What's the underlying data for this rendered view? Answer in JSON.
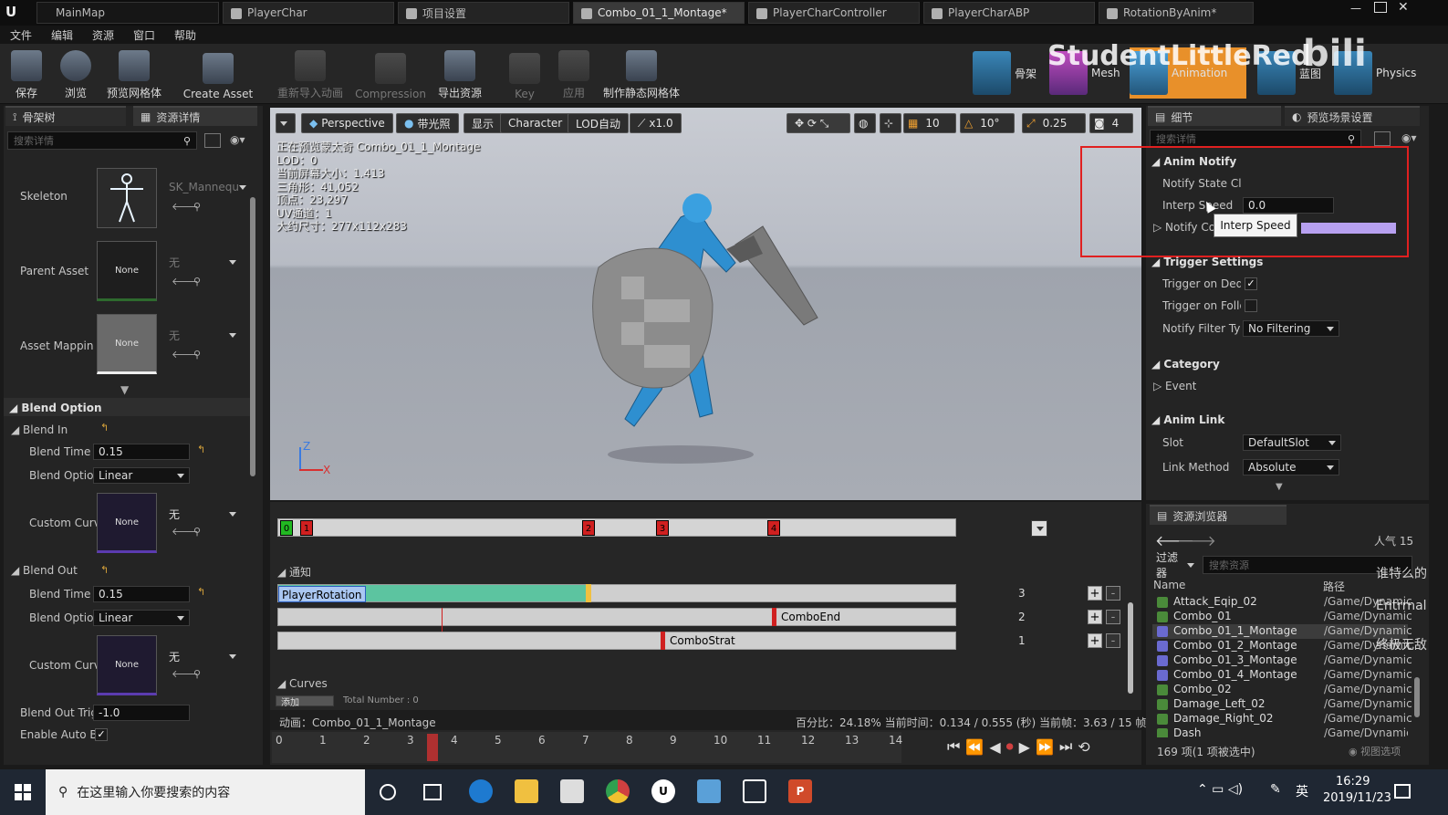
{
  "title_tabs": [
    {
      "label": "MainMap"
    },
    {
      "label": "PlayerChar"
    },
    {
      "label": "项目设置"
    },
    {
      "label": "Combo_01_1_Montage*",
      "active": true
    },
    {
      "label": "PlayerCharController"
    },
    {
      "label": "PlayerCharABP"
    },
    {
      "label": "RotationByAnim*"
    }
  ],
  "menu": [
    "文件",
    "编辑",
    "资源",
    "窗口",
    "帮助"
  ],
  "toolbar": {
    "buttons": [
      "保存",
      "浏览",
      "预览网格体",
      "Create Asset",
      "重新导入动画",
      "Compression",
      "导出资源",
      "Key",
      "应用",
      "制作静态网格体"
    ],
    "modes": [
      "骨架",
      "Mesh",
      "Animation",
      "蓝图",
      "Physics"
    ],
    "watermark": "StudentLittleRed"
  },
  "left_panel": {
    "tabs": [
      "骨架树",
      "资源详情"
    ],
    "search_placeholder": "搜索详情",
    "skeleton_label": "Skeleton",
    "skeleton_value": "SK_Mannequ",
    "parent_label": "Parent Asset",
    "parent_thumb": "None",
    "parent_value": "无",
    "mapping_label": "Asset Mappin",
    "mapping_thumb": "None",
    "mapping_value": "无",
    "blend_option_title": "Blend Option",
    "blend_in_title": "Blend In",
    "blend_out_title": "Blend Out",
    "blend_time_label": "Blend Time",
    "blend_in_time": "0.15",
    "blend_option_label": "Blend Optior",
    "blend_in_option": "Linear",
    "custom_curve_label": "Custom Curv",
    "custom_curve_thumb": "None",
    "custom_curve_value": "无",
    "blend_out_time": "0.15",
    "blend_out_option": "Linear",
    "blend_out_trig_label": "Blend Out Trig",
    "blend_out_trig_value": "-1.0",
    "enable_auto_label": "Enable Auto B"
  },
  "viewport": {
    "buttons": [
      "Perspective",
      "带光照",
      "显示",
      "Character",
      "LOD自动",
      "x1.0"
    ],
    "snap_values": [
      "10",
      "10°",
      "0.25",
      "4"
    ],
    "info": [
      "正在预览蒙太奇 Combo_01_1_Montage",
      "LOD：0",
      "当前屏幕大小：1.413",
      "三角形：41,052",
      "顶点：23,297",
      "UV通道：1",
      "大约尺寸：277x112x283"
    ],
    "axis_z": "Z",
    "axis_x": "X"
  },
  "montage": {
    "markers": [
      "0",
      "1",
      "2",
      "3",
      "4"
    ],
    "notify_title": "通知",
    "notify_rows": [
      {
        "label": "PlayerRotation",
        "count": "3"
      },
      {
        "label": "ComboEnd",
        "count": "2"
      },
      {
        "label": "ComboStrat",
        "count": "1"
      }
    ],
    "curves_title": "Curves",
    "curves_add": "添加",
    "curves_total": "Total Number : 0",
    "anim_label": "动画：Combo_01_1_Montage",
    "percent_text": "百分比：24.18%  当前时间：0.134 / 0.555 (秒)  当前帧：3.63 / 15 帧",
    "ruler": [
      "0",
      "1",
      "2",
      "3",
      "4",
      "5",
      "6",
      "7",
      "8",
      "9",
      "10",
      "11",
      "12",
      "13",
      "14"
    ]
  },
  "details": {
    "tabs": [
      "细节",
      "预览场景设置"
    ],
    "search_placeholder": "搜索详情",
    "anim_notify_title": "Anim Notify",
    "notify_state_label": "Notify State Cla",
    "interp_speed_label": "Interp Speed",
    "interp_speed_value": "0.0",
    "notify_color_label": "Notify Colo",
    "tooltip": "Interp Speed",
    "trigger_title": "Trigger Settings",
    "trigger_dedicated_label": "Trigger on Dedic",
    "trigger_dedicated_checked": true,
    "trigger_follower_label": "Trigger on Follo",
    "trigger_follower_checked": false,
    "filter_type_label": "Notify Filter Typ",
    "filter_type_value": "No Filtering",
    "category_title": "Category",
    "event_label": "Event",
    "anim_link_title": "Anim Link",
    "slot_label": "Slot",
    "slot_value": "DefaultSlot",
    "link_method_label": "Link Method",
    "link_method_value": "Absolute",
    "highlight_color": "#e02020"
  },
  "content_browser": {
    "tab": "资源浏览器",
    "popularity": "人气 15",
    "filter_label": "过滤器",
    "search_placeholder": "搜索资源",
    "col_name": "Name",
    "col_path": "路径",
    "items": [
      {
        "name": "Attack_Eqip_02",
        "path": "/Game/Dynamic"
      },
      {
        "name": "Combo_01",
        "path": "/Game/Dynamic"
      },
      {
        "name": "Combo_01_1_Montage",
        "path": "/Game/Dynamic",
        "selected": true
      },
      {
        "name": "Combo_01_2_Montage",
        "path": "/Game/Dynamic"
      },
      {
        "name": "Combo_01_3_Montage",
        "path": "/Game/Dynamic"
      },
      {
        "name": "Combo_01_4_Montage",
        "path": "/Game/Dynamic"
      },
      {
        "name": "Combo_02",
        "path": "/Game/Dynamic"
      },
      {
        "name": "Damage_Left_02",
        "path": "/Game/Dynamic"
      },
      {
        "name": "Damage_Right_02",
        "path": "/Game/Dynamic"
      },
      {
        "name": "Dash",
        "path": "/Game/Dynamic"
      }
    ],
    "status": "169 项(1 项被选中)",
    "view_options": "视图选项",
    "overlay_texts": [
      "谁特么的",
      "Entrrnal",
      "终极无敌"
    ]
  },
  "taskbar": {
    "search_placeholder": "在这里输入你要搜索的内容",
    "ime": "英",
    "time": "16:29",
    "date": "2019/11/23"
  }
}
